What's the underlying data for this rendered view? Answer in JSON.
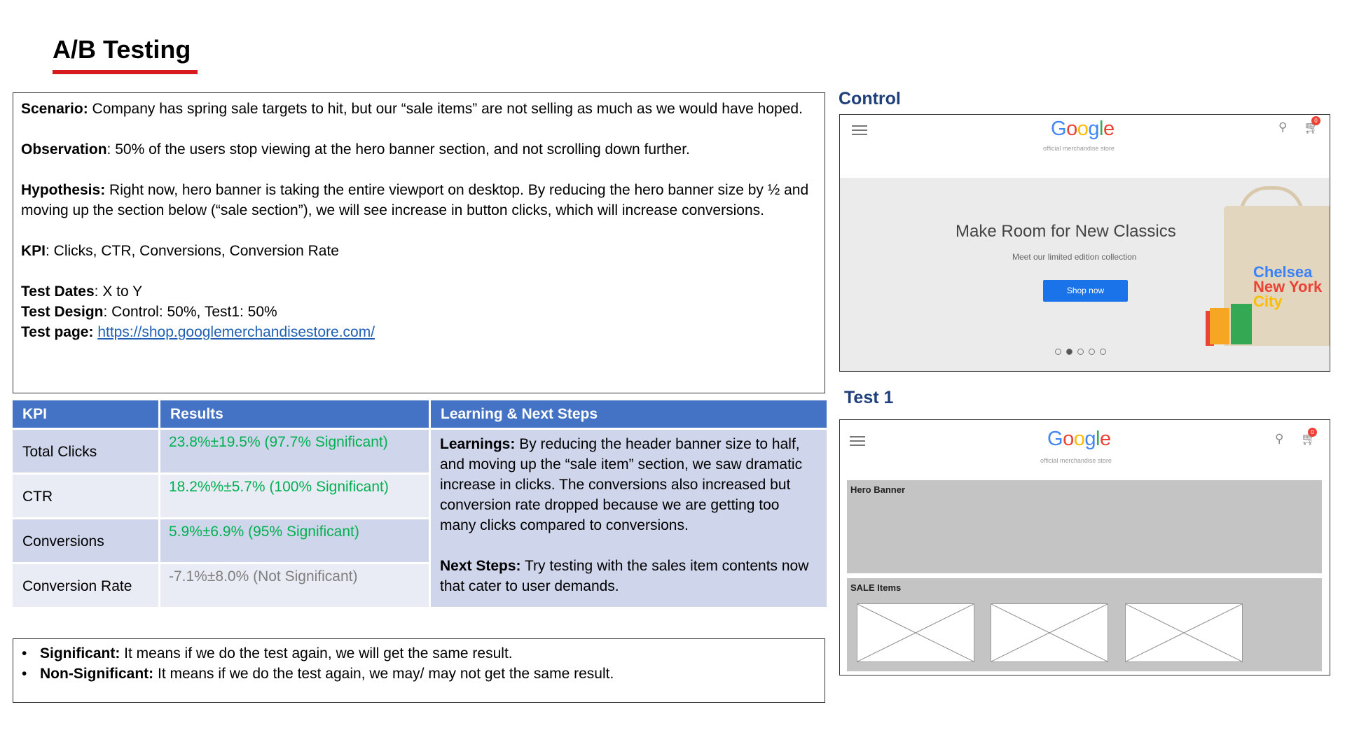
{
  "title": "A/B Testing",
  "scenario": {
    "scenario_label": "Scenario:",
    "scenario_text": " Company has spring sale targets to hit, but our “sale items” are not selling as much as we would have hoped.",
    "observation_label": "Observation",
    "observation_text": ": 50% of the users stop viewing at the hero banner section, and not scrolling down further.",
    "hypothesis_label": "Hypothesis:",
    "hypothesis_text": " Right now, hero banner is taking the entire viewport on desktop. By reducing the hero banner size by ½ and moving up the section below (“sale section”), we will see increase in button clicks, which will increase conversions.",
    "kpi_label": "KPI",
    "kpi_text": ": Clicks, CTR, Conversions, Conversion Rate",
    "test_dates_label": "Test Dates",
    "test_dates_text": ":  X to Y",
    "test_design_label": "Test Design",
    "test_design_text": ": Control: 50%, Test1: 50%",
    "test_page_label": "Test page:",
    "test_page_link": "https://shop.googlemerchandisestore.com/"
  },
  "results_table": {
    "headers": [
      "KPI",
      "Results",
      "Learning & Next Steps"
    ],
    "rows": [
      {
        "kpi": "Total Clicks",
        "result": "23.8%±19.5% (97.7% Significant)"
      },
      {
        "kpi": "CTR",
        "result": "18.2%%±5.7% (100% Significant)"
      },
      {
        "kpi": "Conversions",
        "result": "5.9%±6.9% (95% Significant)"
      },
      {
        "kpi": "Conversion Rate",
        "result": "-7.1%±8.0% (Not Significant)"
      }
    ],
    "learnings_label": "Learnings:",
    "learnings_text": " By reducing the header banner size to half, and moving up the “sale item” section, we saw dramatic increase in clicks. The conversions also increased but conversion rate dropped because we are getting too many clicks compared to conversions.",
    "next_steps_label": "Next Steps:",
    "next_steps_text": " Try testing with the sales item contents now that cater to user demands."
  },
  "significance_notes": [
    {
      "label": "Significant:",
      "text": " It means if we do the test again, we will get the same result."
    },
    {
      "label": "Non-Significant:",
      "text": " It means if we do the test again, we may/ may not get the same result."
    }
  ],
  "control": {
    "label": "Control",
    "logo": {
      "g1": "G",
      "o1": "o",
      "o2": "o",
      "g2": "g",
      "l": "l",
      "e": "e"
    },
    "store_subtitle": "official merchandise store",
    "cart_count": "0",
    "hero_title": "Make Room for New Classics",
    "hero_subtitle": "Meet our limited edition collection",
    "hero_button": "Shop now",
    "tote_lines": [
      "Chelsea",
      "New York",
      "City"
    ]
  },
  "test1": {
    "label": "Test 1",
    "store_subtitle": "official merchandise store",
    "cart_count": "0",
    "hero_banner_label": "Hero Banner",
    "sale_items_label": "SALE Items"
  },
  "icons": [
    "hamburger-menu-icon",
    "search-icon",
    "cart-icon"
  ],
  "colors": {
    "title_underline": "#d71920",
    "table_header": "#4472c4",
    "significant": "#00b050",
    "not_significant": "#7f7f7f",
    "label_blue": "#1f3f7a"
  }
}
